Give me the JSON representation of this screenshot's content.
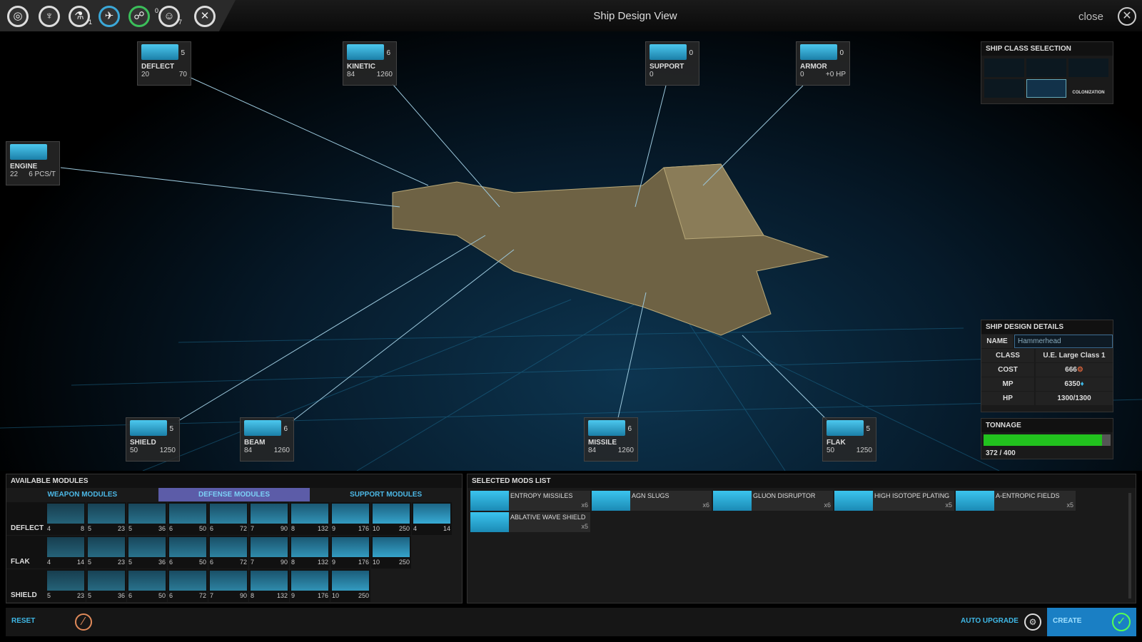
{
  "window": {
    "title": "Ship Design View",
    "close_label": "close"
  },
  "topbar": {
    "icons": [
      "galaxy-icon",
      "empire-icon",
      "research-icon",
      "military-icon",
      "diplomacy-icon",
      "population-icon",
      "settings-icon"
    ],
    "badges": {
      "research": "1",
      "population_top": "0",
      "population_bottom": "7"
    }
  },
  "slots": [
    {
      "key": "deflect",
      "label": "DEFLECT",
      "count": "5",
      "a": "20",
      "b": "70"
    },
    {
      "key": "kinetic",
      "label": "KINETIC",
      "count": "6",
      "a": "84",
      "b": "1260"
    },
    {
      "key": "support",
      "label": "SUPPORT",
      "count": "0",
      "a": "0",
      "b": ""
    },
    {
      "key": "armor",
      "label": "ARMOR",
      "count": "0",
      "a": "0",
      "b": "+0 HP"
    },
    {
      "key": "engine",
      "label": "ENGINE",
      "count": "",
      "a": "22",
      "b": "6 PCS/T"
    },
    {
      "key": "shield",
      "label": "SHIELD",
      "count": "5",
      "a": "50",
      "b": "1250"
    },
    {
      "key": "beam",
      "label": "BEAM",
      "count": "6",
      "a": "84",
      "b": "1260"
    },
    {
      "key": "missile",
      "label": "MISSILE",
      "count": "6",
      "a": "84",
      "b": "1260"
    },
    {
      "key": "flak",
      "label": "FLAK",
      "count": "5",
      "a": "50",
      "b": "1250"
    }
  ],
  "ship_class": {
    "title": "SHIP CLASS SELECTION",
    "colonization_label": "COLONIZATION"
  },
  "details": {
    "title": "SHIP DESIGN DETAILS",
    "name_label": "NAME",
    "name_value": "Hammerhead",
    "class_label": "CLASS",
    "class_value": "U.E. Large Class 1",
    "cost_label": "COST",
    "cost_value": "666",
    "mp_label": "MP",
    "mp_value": "6350",
    "hp_label": "HP",
    "hp_value": "1300/1300"
  },
  "tonnage": {
    "title": "TONNAGE",
    "used": 372,
    "max": 400,
    "text": "372 / 400",
    "bar_color": "#22c21e"
  },
  "available": {
    "title": "AVAILABLE MODULES",
    "tabs": [
      "WEAPON MODULES",
      "DEFENSE MODULES",
      "SUPPORT MODULES"
    ],
    "active_tab": 1,
    "rows": [
      {
        "label": "DEFLECT",
        "cells": [
          [
            "4",
            "8"
          ],
          [
            "5",
            "23"
          ],
          [
            "5",
            "36"
          ],
          [
            "6",
            "50"
          ],
          [
            "6",
            "72"
          ],
          [
            "7",
            "90"
          ],
          [
            "8",
            "132"
          ],
          [
            "9",
            "176"
          ],
          [
            "10",
            "250"
          ],
          [
            "4",
            "14"
          ]
        ]
      },
      {
        "label": "FLAK",
        "cells": [
          [
            "4",
            "14"
          ],
          [
            "5",
            "23"
          ],
          [
            "5",
            "36"
          ],
          [
            "6",
            "50"
          ],
          [
            "6",
            "72"
          ],
          [
            "7",
            "90"
          ],
          [
            "8",
            "132"
          ],
          [
            "9",
            "176"
          ],
          [
            "10",
            "250"
          ]
        ]
      },
      {
        "label": "SHIELD",
        "cells": [
          [
            "5",
            "23"
          ],
          [
            "5",
            "36"
          ],
          [
            "6",
            "50"
          ],
          [
            "6",
            "72"
          ],
          [
            "7",
            "90"
          ],
          [
            "8",
            "132"
          ],
          [
            "9",
            "176"
          ],
          [
            "10",
            "250"
          ]
        ]
      }
    ]
  },
  "selected": {
    "title": "SELECTED MODS LIST",
    "mods": [
      {
        "name": "ENTROPY MISSILES",
        "qty": "x6"
      },
      {
        "name": "AGN SLUGS",
        "qty": "x6"
      },
      {
        "name": "GLUON DISRUPTOR",
        "qty": "x6"
      },
      {
        "name": "HIGH ISOTOPE PLATING",
        "qty": "x5"
      },
      {
        "name": "A-ENTROPIC FIELDS",
        "qty": "x5"
      },
      {
        "name": "ABLATIVE WAVE SHIELD",
        "qty": "x5"
      }
    ]
  },
  "bottom": {
    "reset_label": "RESET",
    "auto_upgrade_label": "AUTO UPGRADE",
    "create_label": "CREATE"
  },
  "colors": {
    "accent": "#3fb8e6",
    "create_bg": "#1a7fc4",
    "reset_icon": "#e08a5a",
    "tab_active": "#5c5ca8"
  }
}
